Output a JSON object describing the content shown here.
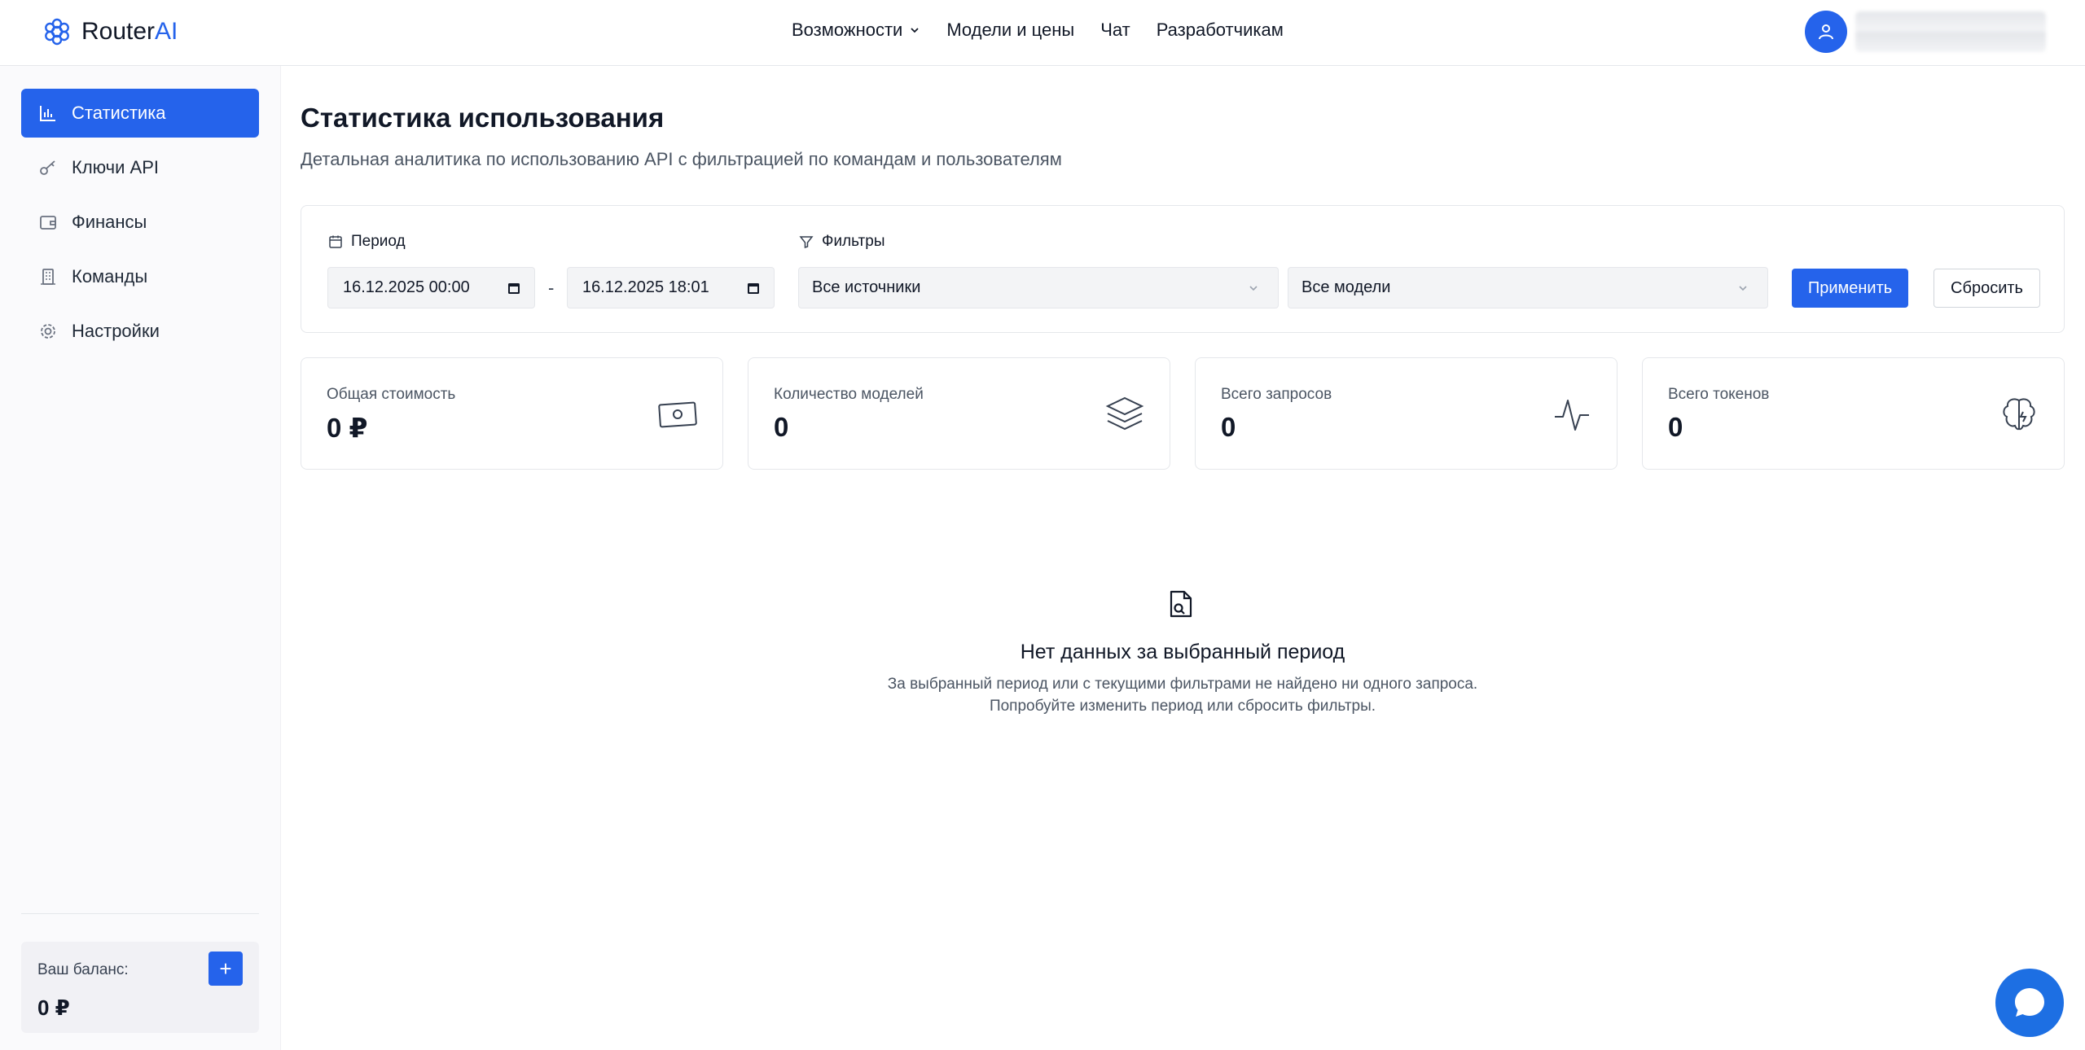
{
  "header": {
    "logo_text_main": "Router",
    "logo_text_accent": "AI",
    "nav": [
      {
        "label": "Возможности",
        "has_dropdown": true
      },
      {
        "label": "Модели и цены"
      },
      {
        "label": "Чат"
      },
      {
        "label": "Разработчикам"
      }
    ]
  },
  "sidebar": {
    "items": [
      {
        "label": "Статистика",
        "icon": "bar-chart-icon",
        "active": true
      },
      {
        "label": "Ключи API",
        "icon": "key-icon"
      },
      {
        "label": "Финансы",
        "icon": "wallet-icon"
      },
      {
        "label": "Команды",
        "icon": "building-icon"
      },
      {
        "label": "Настройки",
        "icon": "gear-icon"
      }
    ],
    "balance": {
      "label": "Ваш баланс:",
      "value": "0 ₽",
      "add_label": "+"
    }
  },
  "main": {
    "title": "Статистика использования",
    "subtitle": "Детальная аналитика по использованию API с фильтрацией по командам и пользователям",
    "filters": {
      "period_label": "Период",
      "date_from": "16.12.2025 00:00",
      "date_separator": "-",
      "date_to": "16.12.2025 18:01",
      "filters_label": "Фильтры",
      "source_select": "Все источники",
      "model_select": "Все модели",
      "apply_label": "Применить",
      "reset_label": "Сбросить"
    },
    "stats": [
      {
        "label": "Общая стоимость",
        "value": "0 ₽",
        "icon": "banknote-icon"
      },
      {
        "label": "Количество моделей",
        "value": "0",
        "icon": "layers-icon"
      },
      {
        "label": "Всего запросов",
        "value": "0",
        "icon": "activity-icon"
      },
      {
        "label": "Всего токенов",
        "value": "0",
        "icon": "brain-icon"
      }
    ],
    "empty_state": {
      "title": "Нет данных за выбранный период",
      "line1": "За выбранный период или с текущими фильтрами не найдено ни одного запроса.",
      "line2": "Попробуйте изменить период или сбросить фильтры."
    }
  },
  "colors": {
    "accent": "#2563eb",
    "chat_button": "#1d6fe3"
  }
}
